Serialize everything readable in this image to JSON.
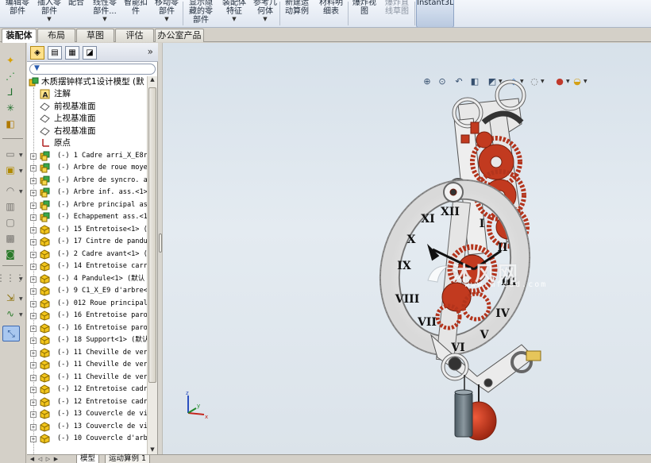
{
  "ribbon": {
    "buttons": [
      {
        "label": "编辑零\n部件",
        "dropdown": false,
        "dim": false
      },
      {
        "label": "插入零\n部件",
        "dropdown": true,
        "dim": false
      },
      {
        "label": "配合",
        "dropdown": false,
        "dim": false
      },
      {
        "label": "线性零\n部件...",
        "dropdown": true,
        "dim": false
      },
      {
        "label": "智能扣\n件",
        "dropdown": false,
        "dim": false
      },
      {
        "label": "移动零\n部件",
        "dropdown": true,
        "dim": false
      },
      {
        "label": "显示隐\n藏的零\n部件",
        "dropdown": false,
        "dim": false
      },
      {
        "label": "装配体\n特征",
        "dropdown": true,
        "dim": false
      },
      {
        "label": "参考几\n何体",
        "dropdown": true,
        "dim": false
      },
      {
        "label": "新建运\n动算例",
        "dropdown": false,
        "dim": false
      },
      {
        "label": "材料明\n细表",
        "dropdown": false,
        "dim": false
      },
      {
        "label": "爆炸视\n图",
        "dropdown": false,
        "dim": false
      },
      {
        "label": "爆炸直\n线草图",
        "dropdown": false,
        "dim": true
      },
      {
        "label": "Instant3D",
        "dropdown": false,
        "dim": false,
        "active": true
      }
    ]
  },
  "tabs": [
    "装配体",
    "布局",
    "草图",
    "评估",
    "办公室产品"
  ],
  "feature_tree": {
    "filter_icon": "funnel-icon",
    "root": "木质摆钟样式1设计模型 (默",
    "items": [
      {
        "label": "注解",
        "icon": "annotation-icon",
        "expand": false,
        "mono": false
      },
      {
        "label": "前视基准面",
        "icon": "plane-icon",
        "expand": false,
        "mono": false
      },
      {
        "label": "上视基准面",
        "icon": "plane-icon",
        "expand": false,
        "mono": false
      },
      {
        "label": "右视基准面",
        "icon": "plane-icon",
        "expand": false,
        "mono": false
      },
      {
        "label": "原点",
        "icon": "origin-icon",
        "expand": false,
        "mono": false
      },
      {
        "label": "(-) 1 Cadre arri_X_E8r",
        "icon": "subassembly-icon",
        "expand": true,
        "mono": true
      },
      {
        "label": "(-) Arbre de roue moye",
        "icon": "subassembly-icon",
        "expand": true,
        "mono": true
      },
      {
        "label": "(-) Arbre de syncro. a",
        "icon": "subassembly-icon",
        "expand": true,
        "mono": true
      },
      {
        "label": "(-) Arbre inf. ass.<1>",
        "icon": "subassembly-icon",
        "expand": true,
        "mono": true
      },
      {
        "label": "(-) Arbre principal as",
        "icon": "subassembly-icon",
        "expand": true,
        "mono": true
      },
      {
        "label": "(-) Echappement ass.<1",
        "icon": "subassembly-icon",
        "expand": true,
        "mono": true
      },
      {
        "label": "(-) 15 Entretoise<1> (",
        "icon": "part-icon",
        "expand": true,
        "mono": true
      },
      {
        "label": "(-) 17 Cintre de pandu",
        "icon": "part-icon",
        "expand": true,
        "mono": true
      },
      {
        "label": "(-) 2 Cadre avant<1> (",
        "icon": "part-icon",
        "expand": true,
        "mono": true
      },
      {
        "label": "(-) 14 Entretoise carr",
        "icon": "part-icon",
        "expand": true,
        "mono": true
      },
      {
        "label": "(-) 4 Pandule<1> (默认",
        "icon": "part-icon",
        "expand": true,
        "mono": true
      },
      {
        "label": "(-) 9 C1_X_E9 d'arbre<",
        "icon": "part-icon",
        "expand": true,
        "mono": true
      },
      {
        "label": "(-) 012 Roue principal",
        "icon": "part-icon",
        "expand": true,
        "mono": true
      },
      {
        "label": "(-) 16 Entretoise paro",
        "icon": "part-icon",
        "expand": true,
        "mono": true
      },
      {
        "label": "(-) 16 Entretoise paro",
        "icon": "part-icon",
        "expand": true,
        "mono": true
      },
      {
        "label": "(-) 18 Support<1> (默认",
        "icon": "part-icon",
        "expand": true,
        "mono": true
      },
      {
        "label": "(-) 11 Cheville de ver",
        "icon": "part-icon",
        "expand": true,
        "mono": true
      },
      {
        "label": "(-) 11 Cheville de ver",
        "icon": "part-icon",
        "expand": true,
        "mono": true
      },
      {
        "label": "(-) 11 Cheville de ver",
        "icon": "part-icon",
        "expand": true,
        "mono": true
      },
      {
        "label": "(-) 12 Entretoise cadr",
        "icon": "part-icon",
        "expand": true,
        "mono": true
      },
      {
        "label": "(-) 12 Entretoise cadr",
        "icon": "part-icon",
        "expand": true,
        "mono": true
      },
      {
        "label": "(-) 13 Couvercle de vi",
        "icon": "part-icon",
        "expand": true,
        "mono": true
      },
      {
        "label": "(-) 13 Couvercle de vi",
        "icon": "part-icon",
        "expand": true,
        "mono": true
      },
      {
        "label": "(-) 10 Couvercle d'arb",
        "icon": "part-icon",
        "expand": true,
        "mono": true
      }
    ]
  },
  "bottom_tabs": [
    "模型",
    "运动算例 1"
  ],
  "watermark": {
    "main": "沐风网",
    "url": "www.mfcad.com"
  },
  "viewport_toolbar": [
    "zoom-to-fit-icon",
    "zoom-area-icon",
    "previous-view-icon",
    "section-view-icon",
    "view-orientation-icon",
    "display-style-icon",
    "hide-show-icon",
    "edit-appearance-icon",
    "apply-scene-icon"
  ],
  "triad": {
    "x": "x",
    "y": "y",
    "z": "z"
  },
  "colors": {
    "gear": "#b3341c",
    "frame": "#f2f2f2",
    "accent_selection": "#a9c7ef"
  }
}
